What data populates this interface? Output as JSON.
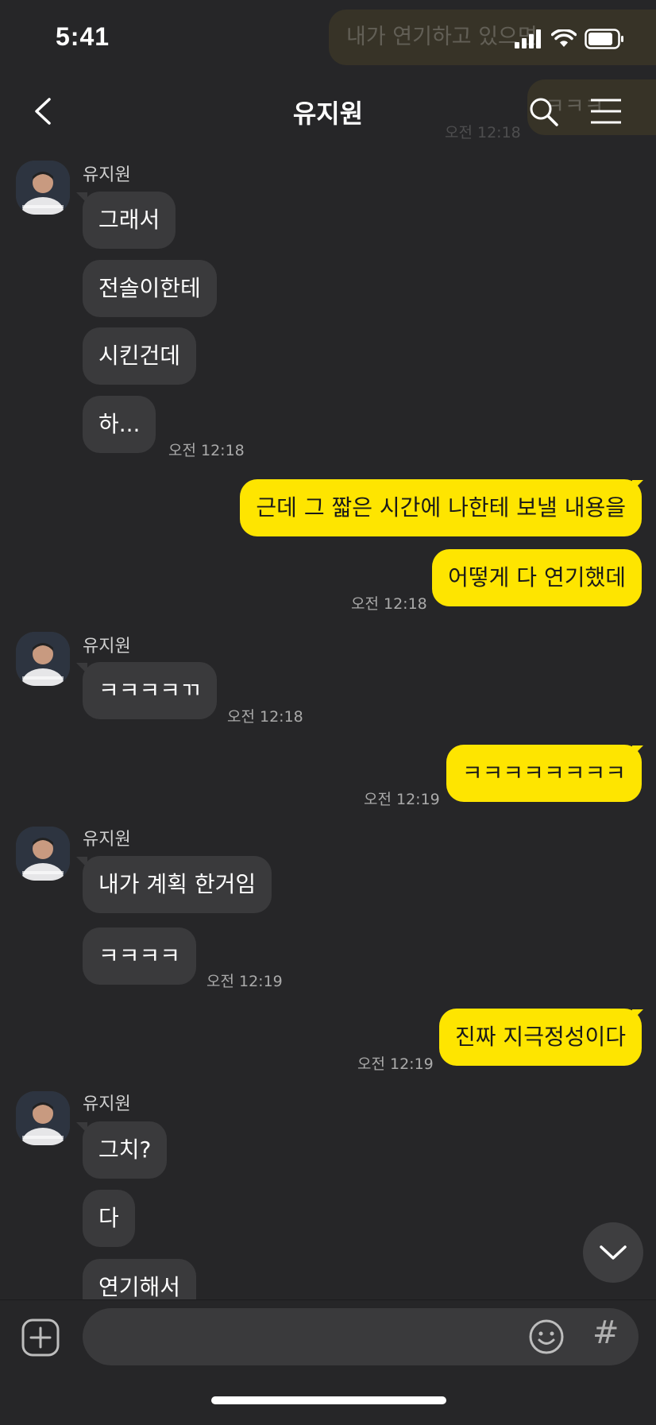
{
  "status": {
    "time": "5:41",
    "ghost_message": "내가 연기하고 있으면",
    "ghost_reply": "ㅋㅋㅋ",
    "ghost_time": "오전 12:18"
  },
  "header": {
    "title": "유지원"
  },
  "messages": [
    {
      "sender": "유지원",
      "texts": [
        "그래서",
        "전솔이한테",
        "시킨건데",
        "하..."
      ],
      "time": "오전 12:18"
    },
    {
      "texts": [
        "근데 그 짧은 시간에 나한테 보낼 내용을",
        "어떻게 다 연기했데"
      ],
      "time": "오전 12:18"
    },
    {
      "sender": "유지원",
      "texts": [
        "ㅋㅋㅋㅋㄲ"
      ],
      "time": "오전 12:18"
    },
    {
      "texts": [
        "ㅋㅋㅋㅋㅋㅋㅋㅋ"
      ],
      "time": "오전 12:19"
    },
    {
      "sender": "유지원",
      "texts": [
        "내가 계획 한거임",
        "ㅋㅋㅋㅋ"
      ],
      "time": "오전 12:19"
    },
    {
      "texts": [
        "진짜 지극정성이다"
      ],
      "time": "오전 12:19"
    },
    {
      "sender": "유지원",
      "texts": [
        "그치?",
        "다",
        "연기해서"
      ]
    }
  ],
  "input": {
    "value": "",
    "placeholder": "",
    "hash_label": "#"
  },
  "icons": {
    "back": "chevron-left-icon",
    "search": "search-icon",
    "menu": "hamburger-menu-icon",
    "plus": "plus-icon",
    "emoji": "emoji-icon",
    "scroll_down": "chevron-down-icon"
  },
  "colors": {
    "background": "#262628",
    "incoming_bubble": "#3a3a3c",
    "outgoing_bubble": "#fee500"
  }
}
